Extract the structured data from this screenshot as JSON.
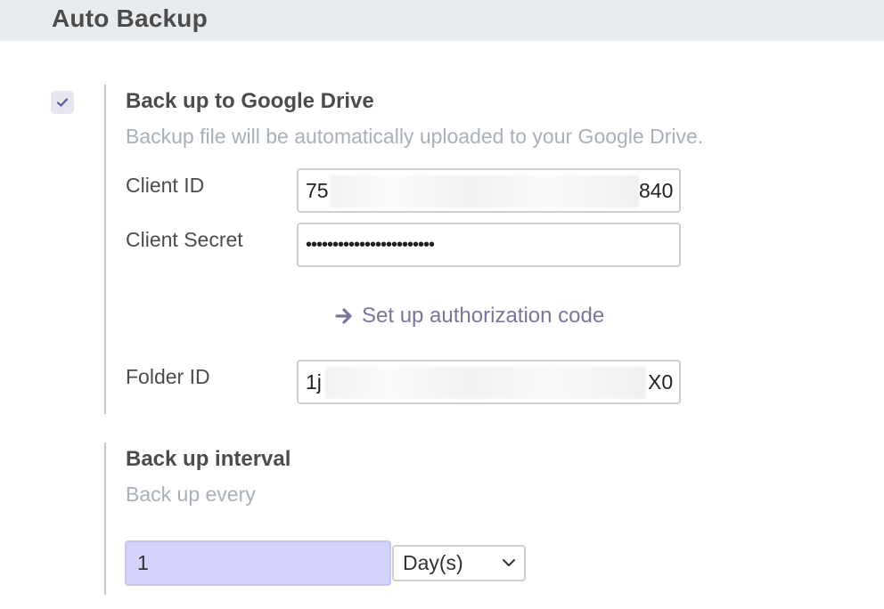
{
  "header": {
    "title": "Auto Backup"
  },
  "google_drive": {
    "enabled": true,
    "title": "Back up to Google Drive",
    "description": "Backup file will be automatically uploaded to your Google Drive.",
    "client_id": {
      "label": "Client ID",
      "visible_start": "75",
      "visible_end": "840"
    },
    "client_secret": {
      "label": "Client Secret",
      "value": "••••••••••••••••••••••••"
    },
    "auth_link": {
      "icon": "arrow-right-icon",
      "label": "Set up authorization code"
    },
    "folder_id": {
      "label": "Folder ID",
      "visible_start": "1j",
      "visible_end": "X0"
    }
  },
  "interval": {
    "title": "Back up interval",
    "description": "Back up every",
    "value": "1",
    "unit": "Day(s)"
  },
  "colors": {
    "header_bg": "#e9ecef",
    "accent_link": "#7b759e",
    "checkbox_bg": "#e6e7ee",
    "interval_input_bg": "#d2d2fb",
    "muted_text": "#a9b0b8"
  }
}
